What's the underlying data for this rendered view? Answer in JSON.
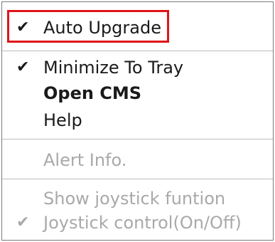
{
  "menu": {
    "items": [
      {
        "label": "Auto Upgrade",
        "checked": true,
        "check_icon": "checkmark-icon"
      },
      {
        "label": "Minimize To Tray",
        "checked": true,
        "check_icon": "checkmark-icon"
      },
      {
        "label": "Open CMS",
        "bold": true
      },
      {
        "label": "Help"
      },
      {
        "label": "Alert Info.",
        "disabled": true
      },
      {
        "label": "Show joystick funtion",
        "disabled": true
      },
      {
        "label": "Joystick control(On/Off)",
        "disabled": true,
        "checked": true,
        "check_icon": "checkmark-icon"
      }
    ],
    "check_glyph": "✔"
  },
  "highlight_color": "#e0141a"
}
